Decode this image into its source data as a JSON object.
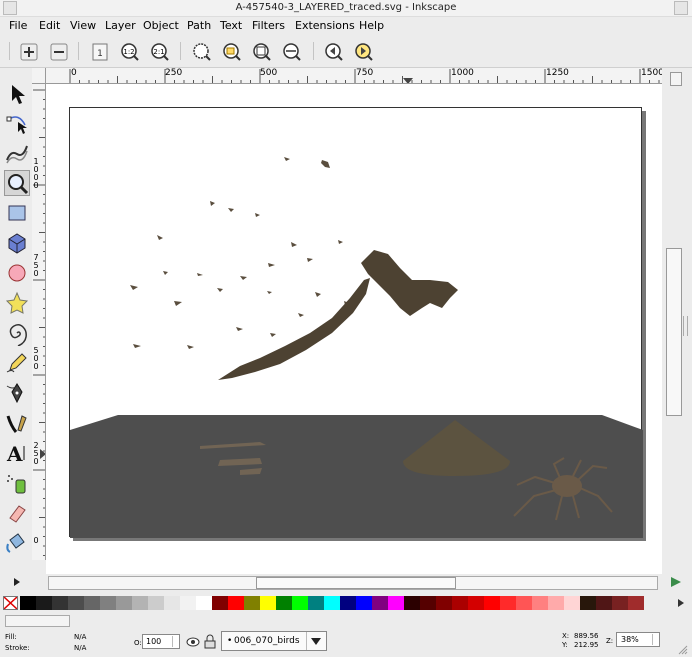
{
  "window": {
    "title": "A-457540-3_LAYERED_traced.svg - Inkscape"
  },
  "menu": [
    {
      "label": "File"
    },
    {
      "label": "Edit"
    },
    {
      "label": "View"
    },
    {
      "label": "Layer"
    },
    {
      "label": "Object"
    },
    {
      "label": "Path"
    },
    {
      "label": "Text"
    },
    {
      "label": "Filters"
    },
    {
      "label": "Extensions"
    },
    {
      "label": "Help"
    }
  ],
  "ruler": {
    "h_labels": [
      "0",
      "250",
      "500",
      "750",
      "1000",
      "1250",
      "1500"
    ],
    "v_labels": [
      "1\n0\n0\n0",
      "7\n5\n0",
      "5\n0\n0",
      "2\n5\n0",
      "0"
    ]
  },
  "statusbar": {
    "fill_label": "Fill:",
    "fill_value": "N/A",
    "stroke_label": "Stroke:",
    "stroke_value": "N/A",
    "opacity_label": "O:",
    "opacity_value": "100",
    "layer_name": "006_070_birds",
    "x_label": "X:",
    "x_value": "889.56",
    "y_label": "Y:",
    "y_value": "212.95",
    "zoom_label": "Z:",
    "zoom_value": "38%"
  },
  "palette": {
    "colors": [
      "#000000",
      "#1a1a1a",
      "#333333",
      "#4d4d4d",
      "#666666",
      "#808080",
      "#999999",
      "#b3b3b3",
      "#cccccc",
      "#e6e6e6",
      "#f2f2f2",
      "#ffffff",
      "#800000",
      "#ff0000",
      "#808000",
      "#ffff00",
      "#008000",
      "#00ff00",
      "#008080",
      "#00ffff",
      "#000080",
      "#0000ff",
      "#800080",
      "#ff00ff",
      "#2b0000",
      "#550000",
      "#800000",
      "#aa0000",
      "#d40000",
      "#ff0000",
      "#ff2a2a",
      "#ff5555",
      "#ff8080",
      "#ffaaaa",
      "#ffd5d5",
      "#28170b",
      "#501616",
      "#782121",
      "#a02c2c"
    ]
  },
  "accent": {
    "floor": "#4e4e4e",
    "bird": "#4d4232",
    "cone": "#5c5340",
    "spider": "#6a5a48"
  }
}
